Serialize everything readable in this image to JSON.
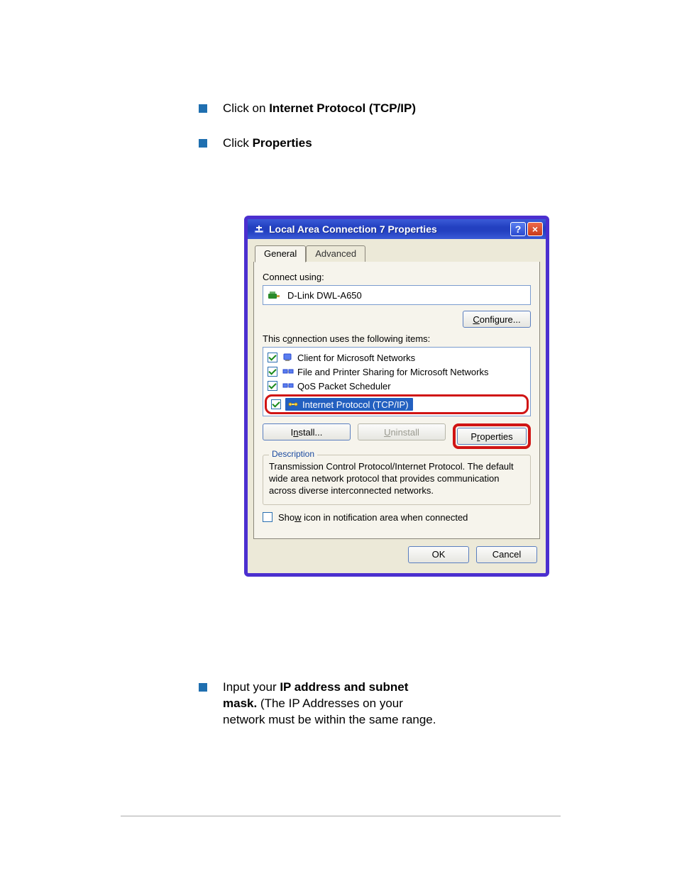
{
  "bullets_top": [
    {
      "pre": "Click on ",
      "bold": "Internet Protocol (TCP/IP)",
      "post": ""
    },
    {
      "pre": "Click ",
      "bold": "Properties",
      "post": ""
    }
  ],
  "bullets_bottom": [
    {
      "pre": "Input your ",
      "bold": "IP address and subnet mask.",
      "post": " (The IP Addresses on your network must be within the same range."
    }
  ],
  "dialog": {
    "title": "Local Area Connection 7 Properties",
    "help_label": "?",
    "close_label": "×",
    "tabs": {
      "general": "General",
      "advanced": "Advanced"
    },
    "connect_using_label": "Connect using:",
    "device_name": "D-Link DWL-A650",
    "configure_label": "Configure...",
    "configure_underline": "C",
    "items_label_pre": "This c",
    "items_label_under": "o",
    "items_label_post": "nnection uses the following items:",
    "items": [
      {
        "name": "Client for Microsoft Networks",
        "checked": true,
        "icon": "client"
      },
      {
        "name": "File and Printer Sharing for Microsoft Networks",
        "checked": true,
        "icon": "service"
      },
      {
        "name": "QoS Packet Scheduler",
        "checked": true,
        "icon": "service"
      },
      {
        "name": "Internet Protocol (TCP/IP)",
        "checked": true,
        "icon": "protocol",
        "selected": true,
        "highlighted": true
      }
    ],
    "buttons": {
      "install": {
        "label": "Install...",
        "under": "n"
      },
      "uninstall": {
        "label": "Uninstall",
        "under": "U",
        "disabled": true
      },
      "properties": {
        "label": "Properties",
        "under": "r",
        "highlighted": true
      }
    },
    "description": {
      "legend": "Description",
      "text": "Transmission Control Protocol/Internet Protocol. The default wide area network protocol that provides communication across diverse interconnected networks."
    },
    "show_icon_pre": "Sho",
    "show_icon_under": "w",
    "show_icon_post": " icon in notification area when connected",
    "ok_label": "OK",
    "cancel_label": "Cancel"
  }
}
